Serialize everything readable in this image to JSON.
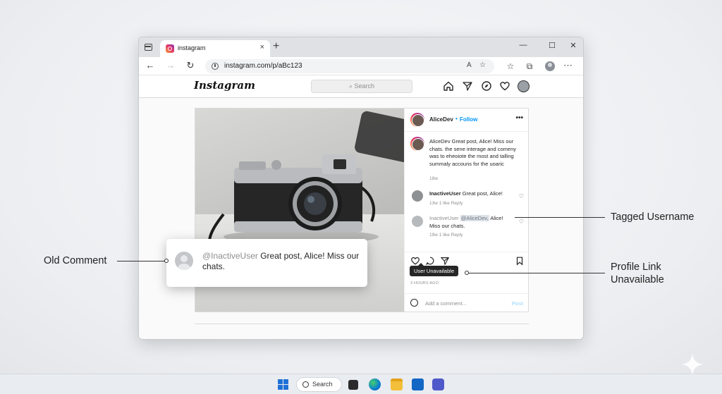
{
  "browser": {
    "tab_title": "instagram",
    "tab_close": "×",
    "new_tab": "+",
    "url": "instagram.com/p/aBc123",
    "controls": {
      "minimize": "—",
      "maximize": "☐",
      "close": "✕"
    },
    "nav": {
      "back": "←",
      "forward": "→",
      "reload": "↻"
    },
    "icons": [
      "read-aloud-icon",
      "favorite-icon",
      "favorites-bar-icon",
      "collections-icon",
      "profile-icon",
      "more-icon"
    ]
  },
  "instagram": {
    "logo": "Instagram",
    "search_placeholder": "Search",
    "header_icons": [
      "home-icon",
      "direct-icon",
      "explore-icon",
      "heart-icon",
      "avatar"
    ],
    "post": {
      "author": "AliceDev",
      "follow_separator": "•",
      "follow": "Follow",
      "more": "•••",
      "caption": "AliceDev Great post, Alice! Miss our chats. the sene interage and comeny was to eheoiote the most and talling summaly accouns for the uoaric",
      "caption_age": "18w",
      "comments": [
        {
          "user": "InactiveUser",
          "text": "Great post, Alice!",
          "meta": "13w   1 like   Reply"
        },
        {
          "user": "InactiveUser",
          "tag": "@AliceDev,",
          "text": "Alice! Miss our chats.",
          "meta": "19w   1 like   Reply"
        }
      ],
      "tooltip": "User Unavailable",
      "time_ago": "3 HOURS AGO",
      "add_comment_placeholder": "Add a comment...",
      "post_button": "Post"
    }
  },
  "zoom_comment": {
    "user": "@InactiveUser",
    "text": "Great post, Alice! Miss our chats."
  },
  "callouts": {
    "old_comment": "Old Comment",
    "tagged_username": "Tagged Username",
    "profile_link": "Profile Link Unavailable"
  },
  "taskbar": {
    "search": "Search",
    "apps": [
      "windows-start-icon",
      "search",
      "task-view-icon",
      "edge-icon",
      "file-explorer-icon",
      "mail-icon",
      "teams-icon"
    ]
  },
  "colors": {
    "instagram_blue": "#0095f6",
    "tooltip_bg": "#262626",
    "tag_highlight": "#dde2e7"
  }
}
